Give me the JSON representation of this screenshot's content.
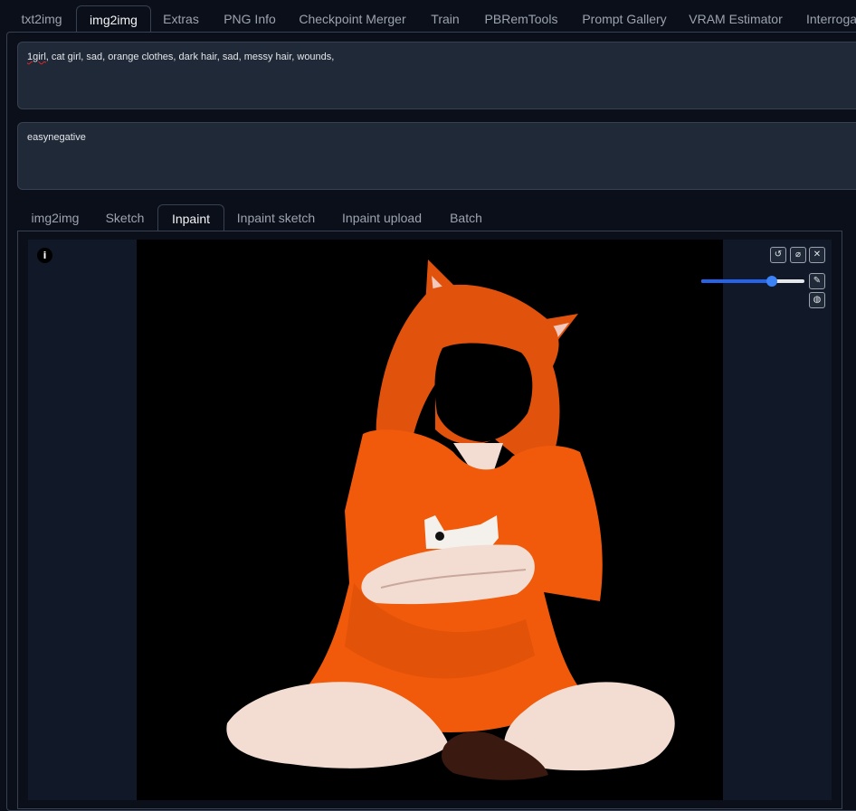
{
  "top_tabs": [
    "txt2img",
    "img2img",
    "Extras",
    "PNG Info",
    "Checkpoint Merger",
    "Train",
    "PBRemTools",
    "Prompt Gallery",
    "VRAM Estimator",
    "Interroga"
  ],
  "active_top_tab": "img2img",
  "prompt": {
    "spell_word": "1girl",
    "rest": ", cat girl, sad, orange clothes, dark hair, sad, messy hair, wounds,"
  },
  "negative_prompt": "easynegative",
  "sub_tabs": [
    "img2img",
    "Sketch",
    "Inpaint",
    "Inpaint sketch",
    "Inpaint upload",
    "Batch"
  ],
  "active_sub_tab": "Inpaint",
  "info_icon": "i",
  "tools": {
    "undo_icon": "↺",
    "clear_icon": "⌀",
    "close_icon": "✕",
    "brush_icon": "✎",
    "color_icon": "◍"
  },
  "brush_size": 0.68,
  "colors": {
    "accent": "#2563eb",
    "orange": "#f05a0a",
    "hair": "#e1520c",
    "skin": "#f3ddd3"
  }
}
